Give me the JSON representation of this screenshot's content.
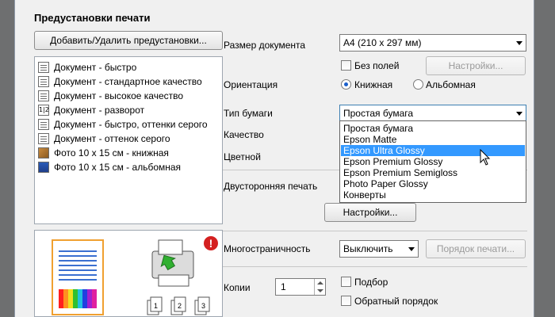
{
  "presets": {
    "title": "Предустановки печати",
    "add_remove_button": "Добавить/Удалить предустановки...",
    "items": [
      {
        "label": "Документ - быстро",
        "icon": "document-icon"
      },
      {
        "label": "Документ - стандартное качество",
        "icon": "document-icon"
      },
      {
        "label": "Документ - высокое качество",
        "icon": "document-icon"
      },
      {
        "label": "Документ - разворот",
        "icon": "booklet-icon",
        "glyph": "1|2"
      },
      {
        "label": "Документ - быстро, оттенки серого",
        "icon": "document-icon"
      },
      {
        "label": "Документ - оттенок серого",
        "icon": "document-icon"
      },
      {
        "label": "Фото 10 x 15 см - книжная",
        "icon": "photo-icon"
      },
      {
        "label": "Фото 10 x 15 см - альбомная",
        "icon": "photo-icon"
      }
    ]
  },
  "settings": {
    "doc_size_label": "Размер документа",
    "doc_size_value": "A4 (210 x 297 мм)",
    "borderless_label": "Без полей",
    "borderless_settings_button": "Настройки...",
    "orientation_label": "Ориентация",
    "orientation_portrait": "Книжная",
    "orientation_landscape": "Альбомная",
    "paper_type_label": "Тип бумаги",
    "paper_type_value": "Простая бумага",
    "paper_type_options": [
      "Простая бумага",
      "Epson Matte",
      "Epson Ultra Glossy",
      "Epson Premium Glossy",
      "Epson Premium Semigloss",
      "Photo Paper Glossy",
      "Конверты"
    ],
    "paper_type_highlighted": "Epson Ultra Glossy",
    "quality_label": "Качество",
    "color_label": "Цветной",
    "duplex_label": "Двусторонняя печать",
    "duplex_settings_button": "Настройки...",
    "multipage_label": "Многостраничность",
    "multipage_value": "Выключить",
    "print_order_button": "Порядок печати...",
    "copies_label": "Копии",
    "copies_value": "1",
    "collate_label": "Подбор",
    "reverse_order_label": "Обратный порядок"
  },
  "preview": {
    "copy_glyphs": [
      "1",
      "2",
      "3"
    ],
    "warning": "!"
  },
  "colors": {
    "highlight": "#3399ff",
    "warning_red": "#d42020",
    "radio_accent": "#1a5fcc"
  }
}
